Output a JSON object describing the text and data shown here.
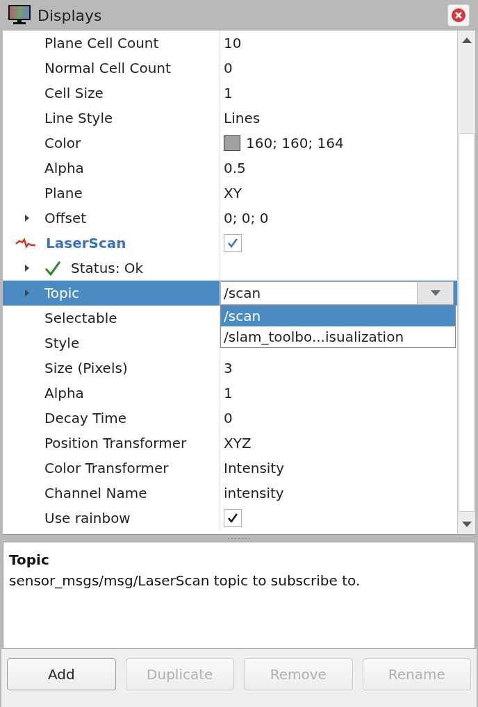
{
  "window": {
    "title": "Displays"
  },
  "rows": [
    {
      "kind": "text",
      "label": "Plane Cell Count",
      "value": "10",
      "selected": false
    },
    {
      "kind": "text",
      "label": "Normal Cell Count",
      "value": "0",
      "selected": false
    },
    {
      "kind": "text",
      "label": "Cell Size",
      "value": "1",
      "selected": false
    },
    {
      "kind": "text",
      "label": "Line Style",
      "value": "Lines",
      "selected": false
    },
    {
      "kind": "color",
      "label": "Color",
      "value": "160; 160; 164",
      "color": "#a0a0a4",
      "selected": false
    },
    {
      "kind": "text",
      "label": "Alpha",
      "value": "0.5",
      "selected": false
    },
    {
      "kind": "text",
      "label": "Plane",
      "value": "XY",
      "selected": false
    },
    {
      "kind": "text",
      "label": "Offset",
      "value": "0; 0; 0",
      "expanded": false,
      "selected": false
    },
    {
      "kind": "display",
      "label": "LaserScan",
      "checked": true,
      "selected": false
    },
    {
      "kind": "status",
      "label": "Status: Ok",
      "expanded": false,
      "selected": false
    },
    {
      "kind": "combo",
      "label": "Topic",
      "value": "/scan",
      "expanded": false,
      "selected": true
    },
    {
      "kind": "text",
      "label": "Selectable",
      "selected": false
    },
    {
      "kind": "text",
      "label": "Style",
      "selected": false
    },
    {
      "kind": "text",
      "label": "Size (Pixels)",
      "value": "3",
      "selected": false
    },
    {
      "kind": "text",
      "label": "Alpha",
      "value": "1",
      "selected": false
    },
    {
      "kind": "text",
      "label": "Decay Time",
      "value": "0",
      "selected": false
    },
    {
      "kind": "text",
      "label": "Position Transformer",
      "value": "XYZ",
      "selected": false
    },
    {
      "kind": "text",
      "label": "Color Transformer",
      "value": "Intensity",
      "selected": false
    },
    {
      "kind": "text",
      "label": "Channel Name",
      "value": "intensity",
      "selected": false
    },
    {
      "kind": "check",
      "label": "Use rainbow",
      "checked": true,
      "selected": false
    }
  ],
  "dropdown": {
    "options": [
      {
        "label": "/scan",
        "selected": true
      },
      {
        "label": "/slam_toolbo...isualization",
        "selected": false
      }
    ]
  },
  "description": {
    "title": "Topic",
    "text": "sensor_msgs/msg/LaserScan topic to subscribe to."
  },
  "buttons": [
    {
      "label": "Add",
      "disabled": false
    },
    {
      "label": "Duplicate",
      "disabled": true
    },
    {
      "label": "Remove",
      "disabled": true
    },
    {
      "label": "Rename",
      "disabled": true
    }
  ]
}
